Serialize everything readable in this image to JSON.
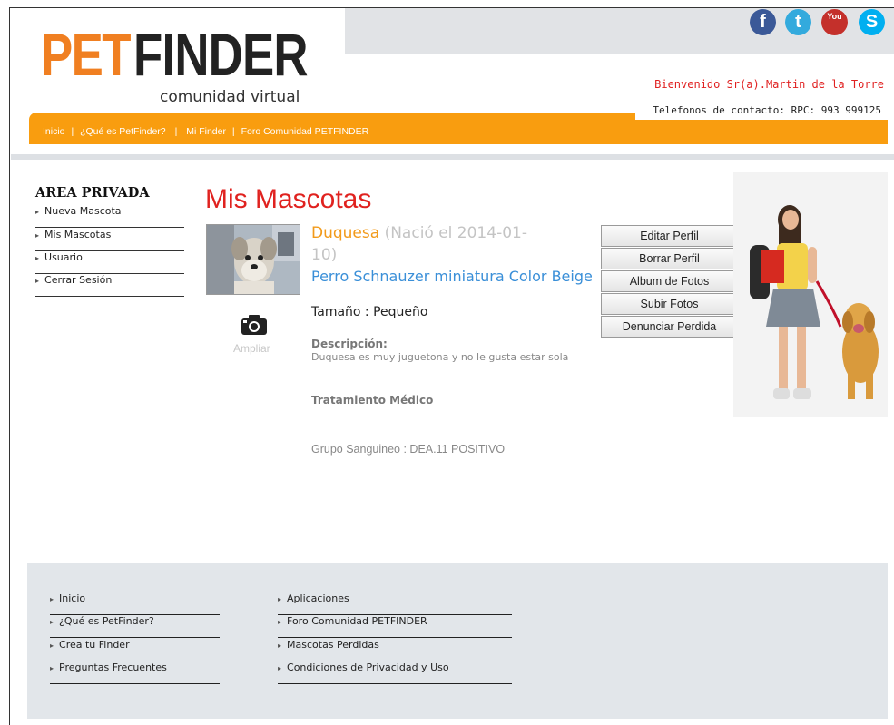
{
  "header": {
    "logo_pet": "PET",
    "logo_finder": "FINDER",
    "logo_sub": "comunidad virtual",
    "welcome": "Bienvenido Sr(a).Martin de la Torre",
    "phone": "Telefonos de contacto: RPC: 993 999125",
    "social": [
      {
        "icon": "facebook-icon",
        "glyph": "f",
        "color": "#3b5998"
      },
      {
        "icon": "twitter-icon",
        "glyph": "t",
        "color": "#33aadd"
      },
      {
        "icon": "youtube-icon",
        "glyph": "You",
        "color": "#c4302b"
      },
      {
        "icon": "skype-icon",
        "glyph": "S",
        "color": "#00aff0"
      }
    ]
  },
  "nav": {
    "items": [
      "Inicio",
      "¿Qué es PetFinder?",
      "Mi Finder",
      "Foro Comunidad PETFINDER"
    ],
    "separator": "|"
  },
  "sidebar": {
    "title": "AREA PRIVADA",
    "items": [
      "Nueva Mascota",
      "Mis Mascotas",
      "Usuario",
      "Cerrar Sesión"
    ]
  },
  "main": {
    "title": "Mis Mascotas",
    "pet": {
      "name": "Duquesa",
      "born_part1": "(Nació el 2014-01-",
      "born_part2": "10)",
      "breed": "Perro Schnauzer miniatura Color Beige",
      "size": "Tamaño : Pequeño",
      "desc_label": "Descripción:",
      "desc_text": "Duquesa es muy juguetona y no le gusta estar sola",
      "treatment_label": "Tratamiento Médico",
      "blood": "Grupo Sanguineo : DEA.11 POSITIVO",
      "zoom_label": "Ampliar"
    },
    "buttons": [
      "Editar Perfil",
      "Borrar Perfil",
      "Album de Fotos",
      "Subir Fotos",
      "Denunciar Perdida"
    ]
  },
  "footer": {
    "col1": [
      "Inicio",
      "¿Qué es PetFinder?",
      "Crea tu Finder",
      "Preguntas Frecuentes"
    ],
    "col2": [
      "Aplicaciones",
      "Foro Comunidad PETFINDER",
      "Mascotas Perdidas",
      "Condiciones de Privacidad y Uso"
    ]
  },
  "colors": {
    "accent_orange": "#f99d0f",
    "logo_orange": "#f07f21",
    "title_red": "#e0221f",
    "link_blue": "#3a8fd8"
  }
}
